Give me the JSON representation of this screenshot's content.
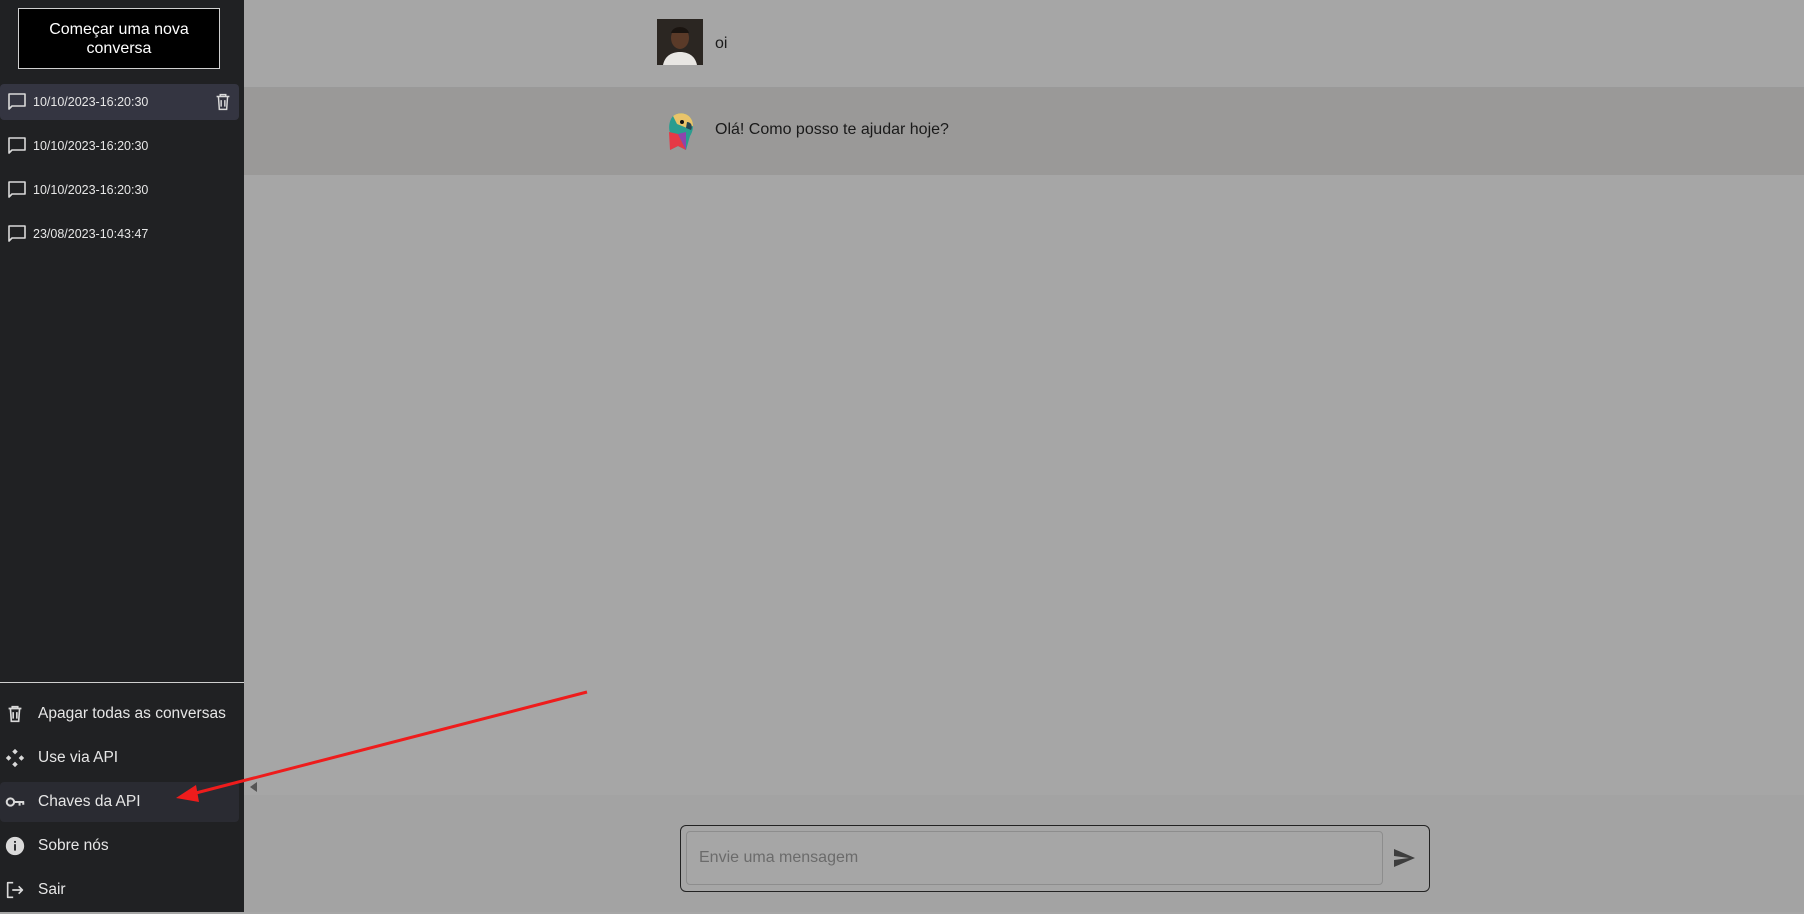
{
  "sidebar": {
    "new_chat_label": "Começar uma nova conversa",
    "conversations": [
      {
        "label": "10/10/2023-16:20:30"
      },
      {
        "label": "10/10/2023-16:20:30"
      },
      {
        "label": "10/10/2023-16:20:30"
      },
      {
        "label": "23/08/2023-10:43:47"
      }
    ],
    "menu": {
      "clear_all": "Apagar todas as conversas",
      "use_api": "Use via API",
      "api_keys": "Chaves da API",
      "about": "Sobre nós",
      "logout": "Sair"
    }
  },
  "chat": {
    "messages": [
      {
        "role": "user",
        "text": "oi",
        "avatar": "user-photo"
      },
      {
        "role": "assistant",
        "text": "Olá! Como posso te ajudar hoje?",
        "avatar": "parrot-logo"
      }
    ]
  },
  "composer": {
    "placeholder": "Envie uma mensagem"
  },
  "colors": {
    "sidebar_bg": "#202123",
    "main_bg": "#a6a6a6",
    "annotation_arrow": "#ee1c1c"
  },
  "icons": [
    "chat-bubble-icon",
    "trash-icon",
    "api-icon",
    "key-icon",
    "info-icon",
    "logout-icon",
    "send-icon",
    "collapse-arrow-icon"
  ]
}
